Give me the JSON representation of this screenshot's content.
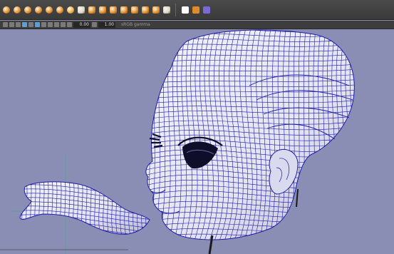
{
  "shelf": {
    "buttons": [
      {
        "name": "poly-sphere-button",
        "color": "#e08a2a"
      },
      {
        "name": "poly-cube-button",
        "color": "#e08a2a"
      },
      {
        "name": "poly-cylinder-button",
        "color": "#e08a2a"
      },
      {
        "name": "poly-cone-button",
        "color": "#e08a2a"
      },
      {
        "name": "poly-torus-button",
        "color": "#e08a2a"
      },
      {
        "name": "poly-plane-button",
        "color": "#e08a2a"
      },
      {
        "name": "poly-disc-button",
        "color": "#e8b04a"
      },
      {
        "name": "combine-button",
        "color": "#d6d6d6"
      },
      {
        "name": "separate-button",
        "color": "#e08a2a"
      },
      {
        "name": "smooth-button",
        "color": "#e08a2a"
      },
      {
        "name": "extrude-button",
        "color": "#e08a2a"
      },
      {
        "name": "bridge-button",
        "color": "#e08a2a"
      },
      {
        "name": "bevel-button",
        "color": "#e08a2a"
      },
      {
        "name": "merge-button",
        "color": "#e08a2a"
      },
      {
        "name": "append-polygon-button",
        "color": "#e08a2a"
      },
      {
        "name": "multi-cut-button",
        "color": "#d6d6d6"
      }
    ],
    "extra": [
      {
        "name": "sculpt-star-button",
        "color": "#ffffff"
      },
      {
        "name": "uv-editor-button",
        "color": "#e08a2a"
      },
      {
        "name": "texture-button",
        "color": "#7a6ad6"
      }
    ]
  },
  "panel_toolbar": {
    "field_one": "0.00",
    "field_two": "1.00",
    "color_space": "sRGB gamma"
  },
  "viewport": {
    "background": "#8a8eb4",
    "wire_color": "#1c1aa8"
  }
}
